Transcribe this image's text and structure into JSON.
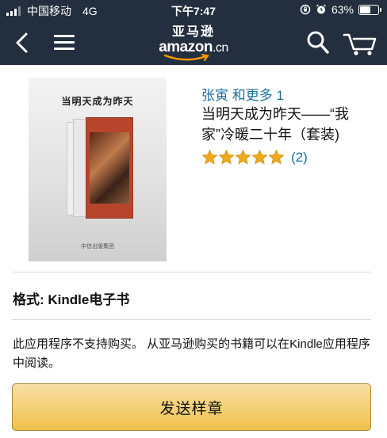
{
  "status_bar": {
    "carrier": "中国移动",
    "network": "4G",
    "time": "下午7:47",
    "battery": "63%",
    "battery_level": 0.63,
    "icons": [
      "signal-icon",
      "orientation-lock-icon",
      "alarm-icon",
      "battery-icon"
    ]
  },
  "nav": {
    "logo_cn": "亚马逊",
    "logo_latin": "amazon",
    "logo_suffix": ".cn",
    "icons": [
      "back-icon",
      "menu-icon",
      "search-icon",
      "cart-icon"
    ]
  },
  "product": {
    "cover_title": "当明天成为昨天",
    "cover_publisher": "中信出版集团",
    "authors": "张寅 和更多 1",
    "title": "当明天成为昨天——“我家”冷暖二十年（套装)",
    "rating_stars": 5,
    "review_count": "(2)",
    "format_label": "格式: Kindle电子书",
    "notice": "此应用程序不支持购买。 从亚马逊购买的书籍可以在Kindle应用程序中阅读。",
    "send_sample_label": "发送样章"
  },
  "colors": {
    "header_bg": "#232f3e",
    "link": "#1b6e9f",
    "star": "#f0a91b",
    "button": "#f0c14b"
  }
}
